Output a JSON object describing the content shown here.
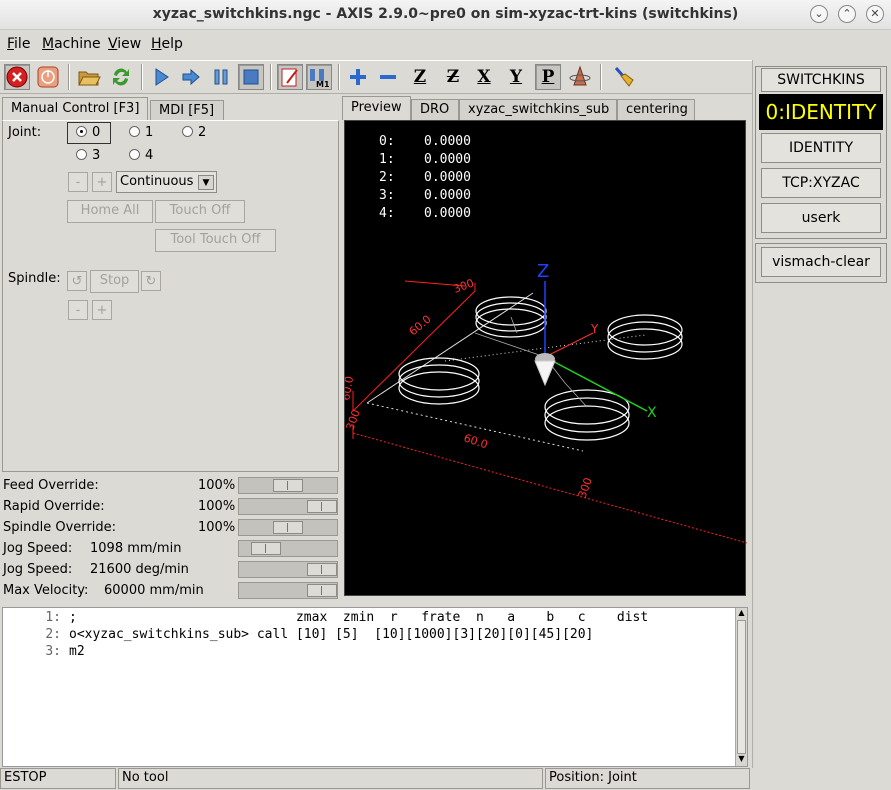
{
  "window": {
    "title": "xyzac_switchkins.ngc - AXIS 2.9.0~pre0 on sim-xyzac-trt-kins (switchkins)"
  },
  "menu": [
    {
      "label": "File",
      "key": "F",
      "rest": "ile"
    },
    {
      "label": "Machine",
      "key": "M",
      "rest": "achine"
    },
    {
      "label": "View",
      "key": "V",
      "rest": "iew"
    },
    {
      "label": "Help",
      "key": "H",
      "rest": "elp"
    }
  ],
  "toolbar": {
    "icons": [
      "estop-icon",
      "power-icon",
      "open-file-icon",
      "reload-icon",
      "run-icon",
      "step-icon",
      "pause-icon",
      "stop-icon",
      "block-delete-icon",
      "optional-stop-icon",
      "zoom-in-icon",
      "zoom-out-icon",
      "view-z-icon",
      "view-z-rotated-icon",
      "view-x-icon",
      "view-y-icon",
      "view-perspective-icon",
      "rotate-view-icon",
      "clear-plot-icon"
    ],
    "view_labels": {
      "z": "Z",
      "z2": "Z",
      "x": "X",
      "y": "Y",
      "p": "P"
    }
  },
  "left_tabs": [
    {
      "label": "Manual Control [F3]"
    },
    {
      "label": "MDI [F5]"
    }
  ],
  "manual": {
    "joint_label": "Joint:",
    "joints": [
      "0",
      "1",
      "2",
      "3",
      "4"
    ],
    "selected_joint": "0",
    "minus": "-",
    "plus": "+",
    "jog_mode": "Continuous",
    "home_all": "Home All",
    "touch_off": "Touch Off",
    "tool_touch_off": "Tool Touch Off",
    "spindle_label": "Spindle:",
    "spindle_stop": "Stop"
  },
  "sliders": [
    {
      "label": "Feed Override:",
      "value": "100",
      "unit": "%",
      "fraction": 0.5
    },
    {
      "label": "Rapid Override:",
      "value": "100",
      "unit": "%",
      "fraction": 1.0
    },
    {
      "label": "Spindle Override:",
      "value": "100",
      "unit": "%",
      "fraction": 0.5
    },
    {
      "label": "Jog Speed:",
      "value": "1098 mm/min",
      "unit": "",
      "fraction": 0.18
    },
    {
      "label": "Jog Speed:",
      "value": "21600 deg/min",
      "unit": "",
      "fraction": 1.0
    },
    {
      "label": "Max Velocity:",
      "value": "60000 mm/min",
      "unit": "",
      "fraction": 1.0
    }
  ],
  "preview_tabs": [
    {
      "label": "Preview"
    },
    {
      "label": "DRO"
    },
    {
      "label": "xyzac_switchkins_sub"
    },
    {
      "label": "centering"
    }
  ],
  "dro": [
    {
      "axis": "0:",
      "value": "0.0000"
    },
    {
      "axis": "1:",
      "value": "0.0000"
    },
    {
      "axis": "2:",
      "value": "0.0000"
    },
    {
      "axis": "3:",
      "value": "0.0000"
    },
    {
      "axis": "4:",
      "value": "0.0000"
    }
  ],
  "plot_labels": {
    "z": "Z",
    "y": "Y",
    "x": "X",
    "dim1": "60.0",
    "dim2": "300",
    "dim3": "60.0",
    "dim4": "300",
    "dim5": "300",
    "dim6": "60.0"
  },
  "colors": {
    "dro_text": "#ffffff",
    "identity_bg": "#000000",
    "identity_text": "#ffff00",
    "extents": "#ff2020",
    "axis_z": "#2040ff",
    "axis_x": "#20d020"
  },
  "code": [
    {
      "n": "1:",
      "text": ";                            zmax  zmin  r   frate  n   a    b   c    dist"
    },
    {
      "n": "2:",
      "text": "o<xyzac_switchkins_sub> call [10] [5]  [10][1000][3][20][0][45][20]"
    },
    {
      "n": "3:",
      "text": "m2"
    }
  ],
  "status": {
    "state": "ESTOP",
    "tool": "No tool",
    "position": "Position: Joint"
  },
  "right": {
    "title": "SWITCHKINS",
    "identity_display": "0:IDENTITY",
    "buttons": [
      "IDENTITY",
      "TCP:XYZAC",
      "userk"
    ],
    "vismach": "vismach-clear"
  }
}
